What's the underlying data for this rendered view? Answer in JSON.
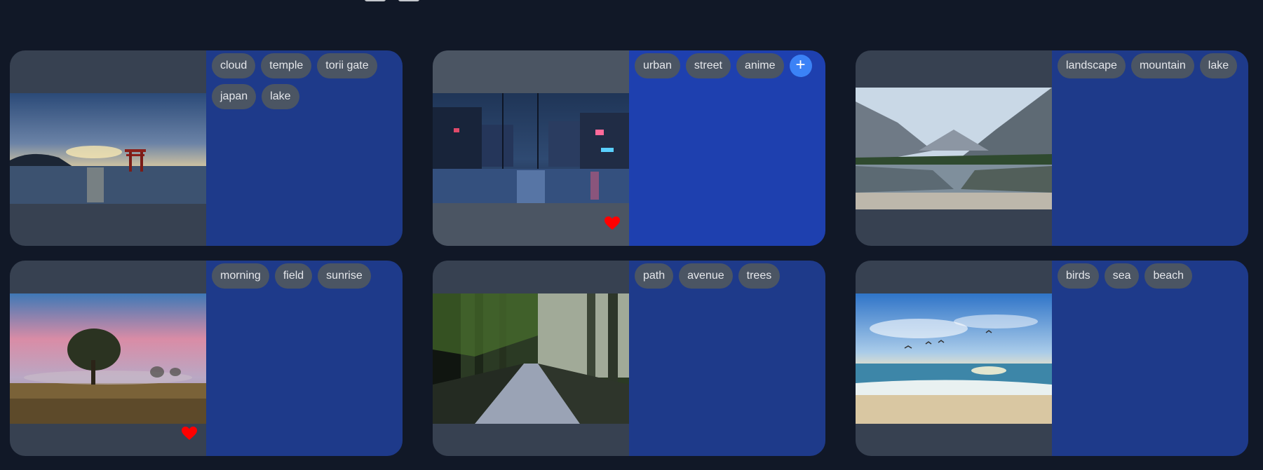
{
  "cards": [
    {
      "tags": [
        "cloud",
        "temple",
        "torii gate",
        "japan",
        "lake"
      ],
      "favorite": false
    },
    {
      "tags": [
        "urban",
        "street",
        "anime"
      ],
      "favorite": true,
      "add_button": "+"
    },
    {
      "tags": [
        "landscape",
        "mountain",
        "lake"
      ],
      "favorite": false
    },
    {
      "tags": [
        "morning",
        "field",
        "sunrise"
      ],
      "favorite": true
    },
    {
      "tags": [
        "path",
        "avenue",
        "trees"
      ],
      "favorite": false
    },
    {
      "tags": [
        "birds",
        "sea",
        "beach"
      ],
      "favorite": false
    }
  ],
  "colors": {
    "background": "#111827",
    "card_media": "#374151",
    "tags_panel": "#1e3a8a",
    "tag_chip": "#4b5563",
    "accent": "#3b82f6",
    "heart": "#ff0000"
  },
  "icons": {
    "favorite": "heart-icon",
    "add": "plus-icon"
  }
}
